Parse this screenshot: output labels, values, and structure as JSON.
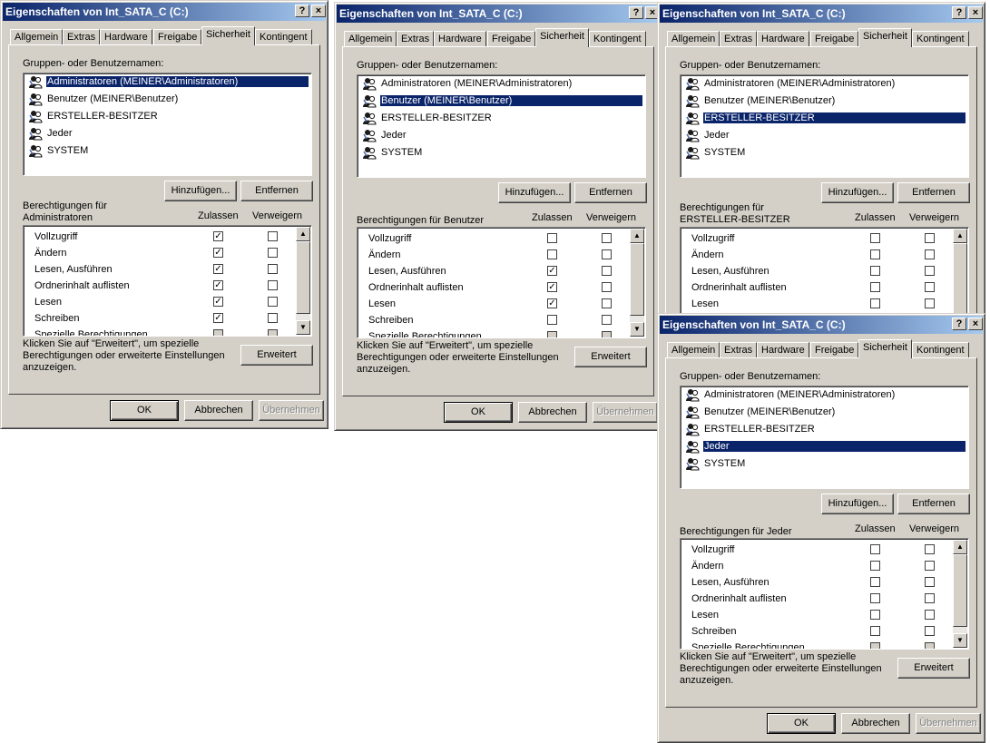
{
  "window_title": "Eigenschaften von Int_SATA_C (C:)",
  "help_btn": "?",
  "close_btn": "×",
  "tabs": [
    "Allgemein",
    "Extras",
    "Hardware",
    "Freigabe",
    "Sicherheit",
    "Kontingent"
  ],
  "groups_label": "Gruppen- oder Benutzernamen:",
  "users": [
    "Administratoren (MEINER\\Administratoren)",
    "Benutzer (MEINER\\Benutzer)",
    "ERSTELLER-BESITZER",
    "Jeder",
    "SYSTEM"
  ],
  "add_button": "Hinzufügen...",
  "remove_button": "Entfernen",
  "allow_header": "Zulassen",
  "deny_header": "Verweigern",
  "permissions": [
    "Vollzugriff",
    "Ändern",
    "Lesen, Ausführen",
    "Ordnerinhalt auflisten",
    "Lesen",
    "Schreiben",
    "Spezielle Berechtigungen"
  ],
  "advanced_note": "Klicken Sie auf \"Erweitert\", um spezielle Berechtigungen oder erweiterte Einstellungen anzuzeigen.",
  "advanced_button": "Erweitert",
  "ok_button": "OK",
  "cancel_button": "Abbrechen",
  "apply_button": "Übernehmen",
  "dialogs": [
    {
      "perm_label_1": "Berechtigungen für",
      "perm_label_2": "Administratoren",
      "selected": 0,
      "allow": [
        1,
        1,
        1,
        1,
        1,
        1,
        0
      ],
      "visible_rows": 7
    },
    {
      "perm_label_1": "Berechtigungen für Benutzer",
      "perm_label_2": "",
      "selected": 1,
      "allow": [
        0,
        0,
        1,
        1,
        1,
        0,
        0
      ],
      "visible_rows": 7
    },
    {
      "perm_label_1": "Berechtigungen für",
      "perm_label_2": "ERSTELLER-BESITZER",
      "selected": 2,
      "allow": [
        0,
        0,
        0,
        0,
        0,
        0,
        0
      ],
      "visible_rows": 5
    },
    {
      "perm_label_1": "Berechtigungen für Jeder",
      "perm_label_2": "",
      "selected": 3,
      "allow": [
        0,
        0,
        0,
        0,
        0,
        0,
        0
      ],
      "visible_rows": 7
    }
  ]
}
